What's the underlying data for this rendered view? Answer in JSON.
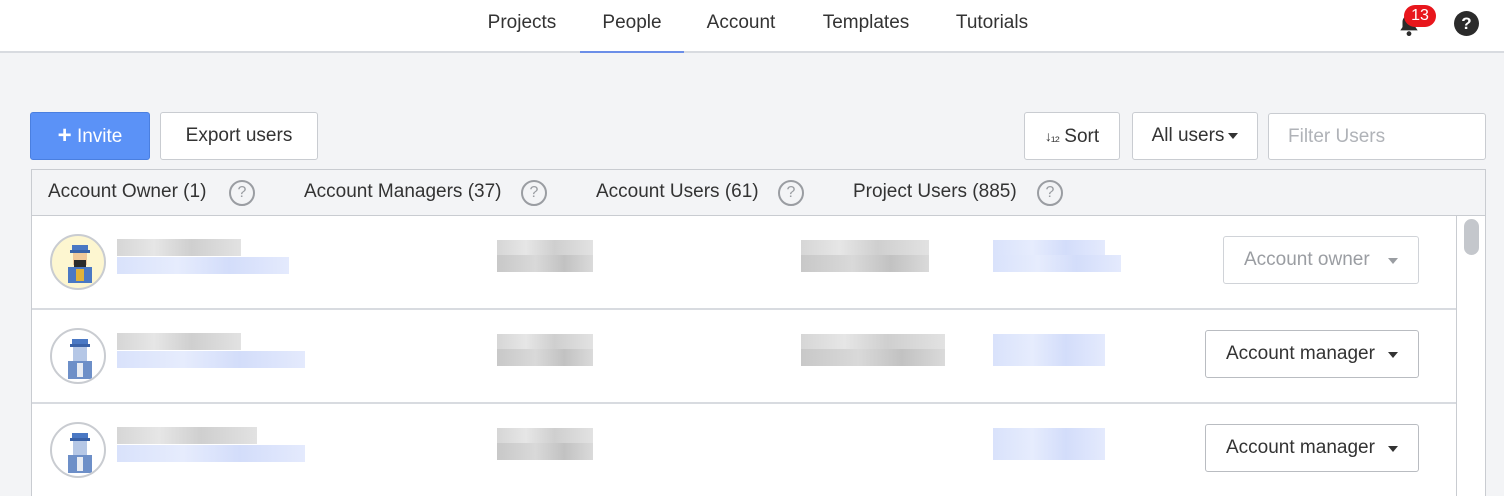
{
  "nav": {
    "tabs": [
      {
        "label": "Projects"
      },
      {
        "label": "People",
        "active": true
      },
      {
        "label": "Account"
      },
      {
        "label": "Templates"
      },
      {
        "label": "Tutorials"
      }
    ],
    "notification_count": "13",
    "help_label": "?"
  },
  "toolbar": {
    "invite_label": "Invite",
    "invite_icon": "plus-icon",
    "export_label": "Export users",
    "sort_label": "Sort",
    "sort_icon": "sort-az-icon",
    "filter_dropdown_label": "All users",
    "filter_placeholder": "Filter Users"
  },
  "categories": [
    {
      "label": "Account Owner (1)"
    },
    {
      "label": "Account Managers (37)"
    },
    {
      "label": "Account Users (61)"
    },
    {
      "label": "Project Users (885)"
    }
  ],
  "users": [
    {
      "role": "Account owner",
      "role_editable": false,
      "avatar": "owner-avatar-icon"
    },
    {
      "role": "Account manager",
      "role_editable": true,
      "avatar": "user-avatar-icon"
    },
    {
      "role": "Account manager",
      "role_editable": true,
      "avatar": "user-avatar-icon"
    }
  ],
  "colors": {
    "primary": "#5b92f7",
    "active_tab_underline": "#6b8ee8",
    "badge": "#e8161c"
  }
}
